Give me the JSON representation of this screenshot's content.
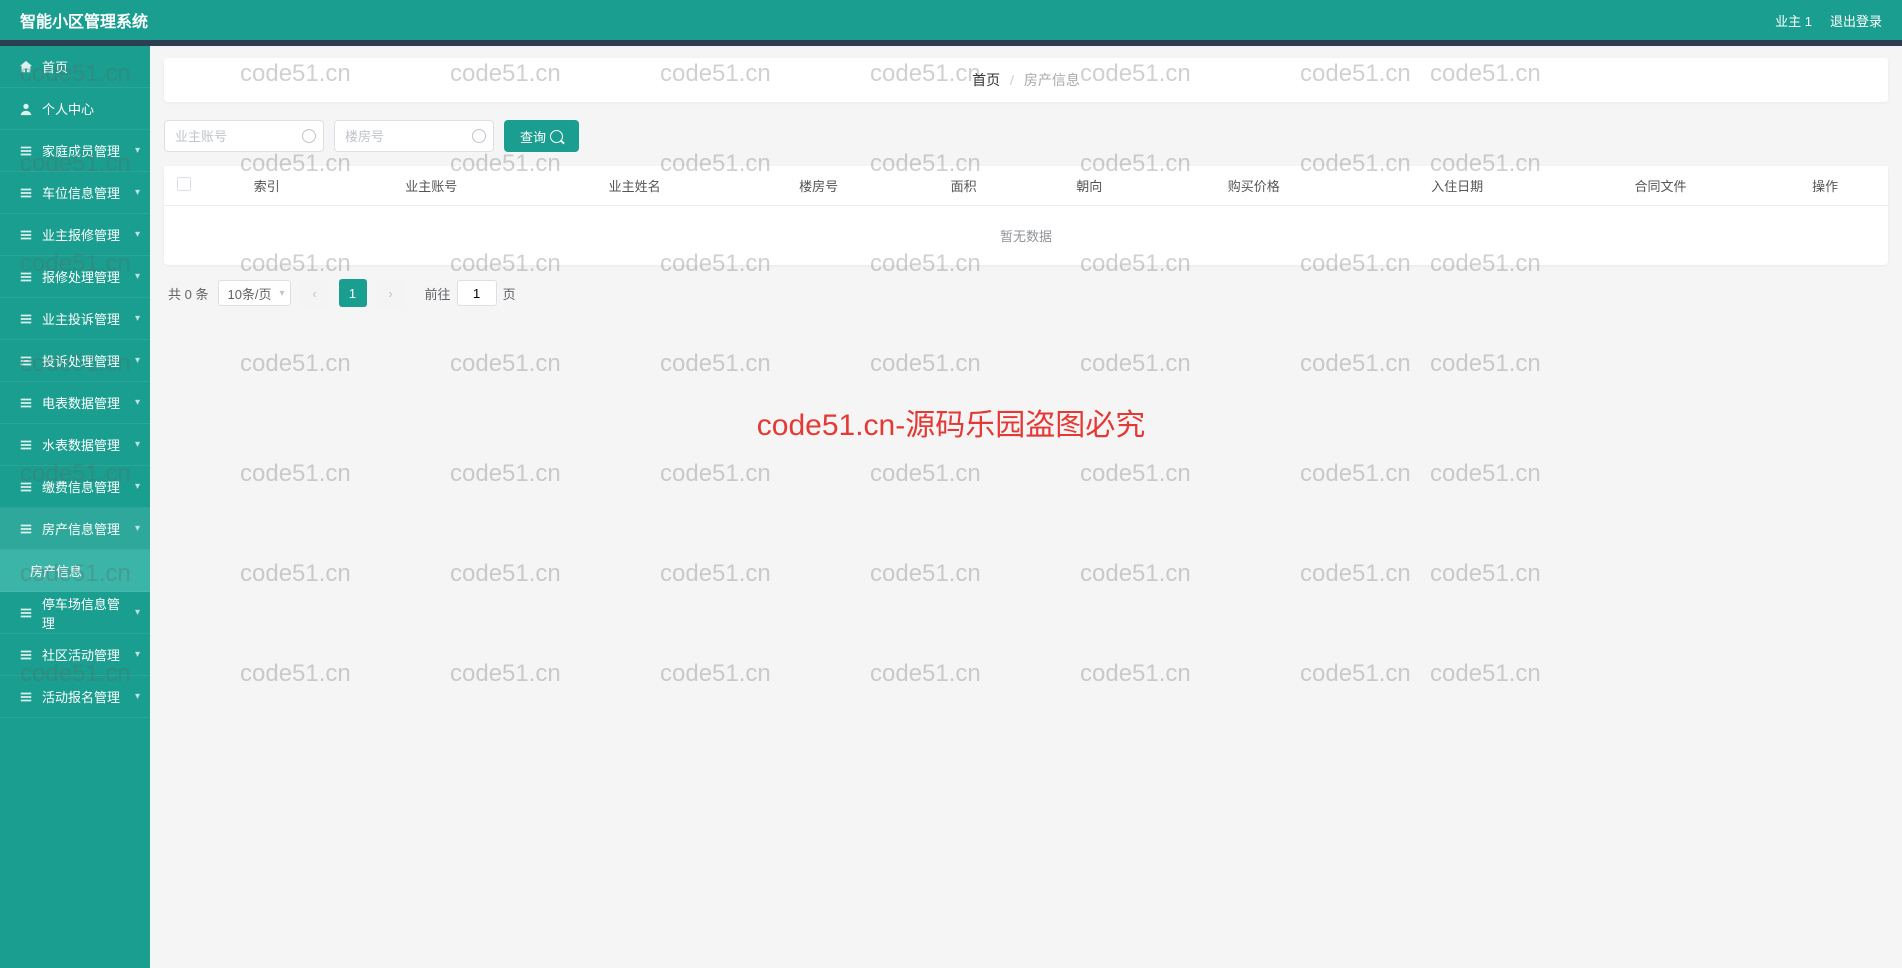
{
  "header": {
    "title": "智能小区管理系统",
    "user": "业主 1",
    "logout": "退出登录"
  },
  "sidebar": {
    "items": [
      {
        "icon": "home",
        "label": "首页",
        "arrow": false
      },
      {
        "icon": "user",
        "label": "个人中心",
        "arrow": false
      },
      {
        "icon": "family",
        "label": "家庭成员管理",
        "arrow": true
      },
      {
        "icon": "car",
        "label": "车位信息管理",
        "arrow": true
      },
      {
        "icon": "repair",
        "label": "业主报修管理",
        "arrow": true
      },
      {
        "icon": "process",
        "label": "报修处理管理",
        "arrow": true
      },
      {
        "icon": "complaint",
        "label": "业主投诉管理",
        "arrow": true
      },
      {
        "icon": "handle",
        "label": "投诉处理管理",
        "arrow": true
      },
      {
        "icon": "elec",
        "label": "电表数据管理",
        "arrow": true
      },
      {
        "icon": "water",
        "label": "水表数据管理",
        "arrow": true
      },
      {
        "icon": "fee",
        "label": "缴费信息管理",
        "arrow": true
      },
      {
        "icon": "house",
        "label": "房产信息管理",
        "arrow": true
      }
    ],
    "subItem": "房产信息",
    "items2": [
      {
        "icon": "parking",
        "label": "停车场信息管理",
        "arrow": true
      },
      {
        "icon": "activity",
        "label": "社区活动管理",
        "arrow": true
      },
      {
        "icon": "signup",
        "label": "活动报名管理",
        "arrow": true
      }
    ]
  },
  "breadcrumb": {
    "home": "首页",
    "current": "房产信息"
  },
  "search": {
    "owner_placeholder": "业主账号",
    "building_placeholder": "楼房号",
    "button": "查询"
  },
  "table": {
    "columns": [
      "索引",
      "业主账号",
      "业主姓名",
      "楼房号",
      "面积",
      "朝向",
      "购买价格",
      "入住日期",
      "合同文件",
      "操作"
    ],
    "empty": "暂无数据"
  },
  "pagination": {
    "total": "共 0 条",
    "pageSize": "10条/页",
    "current": "1",
    "jump_prefix": "前往",
    "jump_suffix": "页",
    "jump_value": "1"
  },
  "watermark": {
    "text": "code51.cn",
    "center": "code51.cn-源码乐园盗图必究"
  }
}
